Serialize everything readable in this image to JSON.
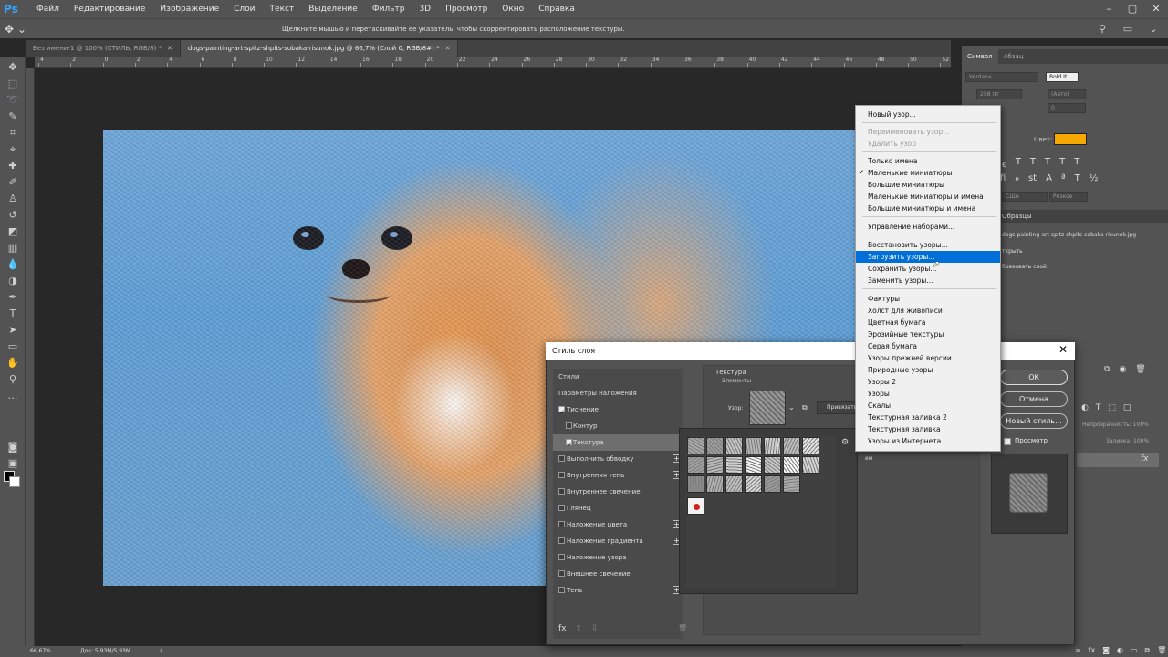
{
  "menubar": {
    "logo": "Ps",
    "items": [
      "Файл",
      "Редактирование",
      "Изображение",
      "Слои",
      "Текст",
      "Выделение",
      "Фильтр",
      "3D",
      "Просмотр",
      "Окно",
      "Справка"
    ]
  },
  "options": {
    "hint": "Щелкните мышью и перетаскивайте ее указатель, чтобы скорректировать расположение текстуры."
  },
  "tabs": [
    {
      "label": "Без имени-1 @ 100% (СТИЛЬ, RGB/8) *"
    },
    {
      "label": "dogs-painting-art-spitz-shpits-sobaka-risunok.jpg @ 66,7% (Слой 0, RGB/8#) *"
    }
  ],
  "ruler_top": [
    "4",
    "2",
    "0",
    "2",
    "4",
    "6",
    "8",
    "10",
    "12",
    "14",
    "16",
    "18",
    "20",
    "22",
    "24",
    "26",
    "28",
    "30",
    "32",
    "34",
    "36",
    "38",
    "40",
    "42",
    "44",
    "46",
    "48",
    "50",
    "52",
    "54"
  ],
  "status": {
    "zoom": "66,67%",
    "doc": "Док: 5,93M/5,93M",
    "arrow": "›"
  },
  "character_panel": {
    "tabs": [
      "Символ",
      "Абзац"
    ],
    "font": "Verdana",
    "style": "Bold It...",
    "size": "258 пт",
    "leading": "(Авто)",
    "tracking": "0",
    "color_label": "Цвет:",
    "color": "#f5a800",
    "lang": "США",
    "aa": "Резкое"
  },
  "history_panel": {
    "tab": "Образцы",
    "items": [
      "dogs-painting-art-spitz-shpits-sobaka-risunok.jpg",
      "ткрыть",
      "бразовать слой"
    ]
  },
  "layers_panel": {
    "opacity_label": "Непрозрачность: 100%",
    "fill_label": "Заливка: 100%",
    "fx": "fx"
  },
  "dialog": {
    "title": "Стиль слоя",
    "close": "✕",
    "styles": [
      {
        "label": "Стили",
        "type": "header"
      },
      {
        "label": "Параметры наложения",
        "type": "header"
      },
      {
        "label": "Тиснение",
        "checked": true,
        "indent": 0
      },
      {
        "label": "Контур",
        "checked": false,
        "indent": 1
      },
      {
        "label": "Текстура",
        "checked": true,
        "indent": 1,
        "active": true
      },
      {
        "label": "Выполнить обводку",
        "checked": false,
        "indent": 0,
        "plus": true
      },
      {
        "label": "Внутренняя тень",
        "checked": false,
        "indent": 0,
        "plus": true
      },
      {
        "label": "Внутреннее свечение",
        "checked": false,
        "indent": 0
      },
      {
        "label": "Глянец",
        "checked": false,
        "indent": 0
      },
      {
        "label": "Наложение цвета",
        "checked": false,
        "indent": 0,
        "plus": true
      },
      {
        "label": "Наложение градиента",
        "checked": false,
        "indent": 0,
        "plus": true
      },
      {
        "label": "Наложение узора",
        "checked": false,
        "indent": 0
      },
      {
        "label": "Внешнее свечение",
        "checked": false,
        "indent": 0
      },
      {
        "label": "Тень",
        "checked": false,
        "indent": 0,
        "plus": true
      }
    ],
    "fx_label": "fx",
    "texture_title": "Текстура",
    "elements_label": "Элементы",
    "pattern_label": "Узор:",
    "snap_label": "Привязать",
    "truncated": "ем",
    "buttons": {
      "ok": "OK",
      "cancel": "Отмена",
      "new_style": "Новый стиль...",
      "preview": "Просмотр"
    }
  },
  "context_menu": {
    "items": [
      {
        "label": "Новый узор...",
        "state": "normal"
      },
      {
        "label": "Переименовать узор...",
        "state": "disabled"
      },
      {
        "label": "Удалить узор",
        "state": "disabled"
      },
      {
        "label": "Только имена",
        "state": "normal"
      },
      {
        "label": "Маленькие миниатюры",
        "state": "checked"
      },
      {
        "label": "Большие миниатюры",
        "state": "normal"
      },
      {
        "label": "Маленькие миниатюры и имена",
        "state": "normal"
      },
      {
        "label": "Большие миниатюры и имена",
        "state": "normal"
      },
      {
        "label": "Управление наборами...",
        "state": "normal"
      },
      {
        "label": "Восстановить узоры...",
        "state": "normal"
      },
      {
        "label": "Загрузить узоры...",
        "state": "highlighted"
      },
      {
        "label": "Сохранить узоры...",
        "state": "normal"
      },
      {
        "label": "Заменить узоры...",
        "state": "normal"
      },
      {
        "label": "Фактуры",
        "state": "normal"
      },
      {
        "label": "Холст для живописи",
        "state": "normal"
      },
      {
        "label": "Цветная бумага",
        "state": "normal"
      },
      {
        "label": "Эрозийные текстуры",
        "state": "normal"
      },
      {
        "label": "Серая бумага",
        "state": "normal"
      },
      {
        "label": "Узоры прежней версии",
        "state": "normal"
      },
      {
        "label": "Природные узоры",
        "state": "normal"
      },
      {
        "label": "Узоры 2",
        "state": "normal"
      },
      {
        "label": "Узоры",
        "state": "normal"
      },
      {
        "label": "Скалы",
        "state": "normal"
      },
      {
        "label": "Текстурная заливка 2",
        "state": "normal"
      },
      {
        "label": "Текстурная заливка",
        "state": "normal"
      },
      {
        "label": "Узоры из Интернета",
        "state": "normal"
      }
    ]
  }
}
